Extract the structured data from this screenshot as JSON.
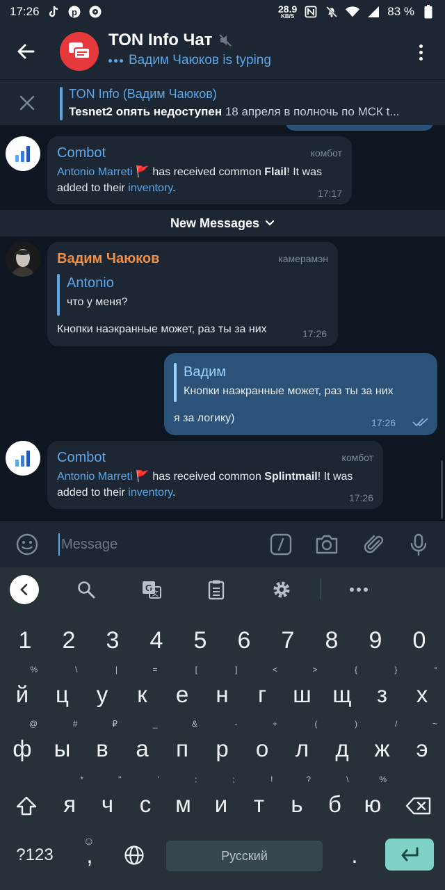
{
  "status_bar": {
    "time": "17:26",
    "net_speed_value": "28.9",
    "net_speed_unit": "KB/S",
    "battery": "83 %"
  },
  "header": {
    "title": "TON Info Чат",
    "typing_status": "Вадим Чаюков is typing",
    "avatar_color": "#e5393b"
  },
  "pinned": {
    "title": "TON Info (Вадим Чаюков)",
    "text_bold": "Tesnet2 опять недоступен",
    "text_rest": " 18 апреля в полночь по МСК t..."
  },
  "messages": [
    {
      "sender": "Combot",
      "role": "комбот",
      "link1": "Antonio Marreti",
      "flag": "🚩",
      "text1": " has received common ",
      "item": "Flail",
      "text2": "! It was",
      "line2_pre": "added to their ",
      "link2": "inventory",
      "line2_post": ".",
      "time": "17:17"
    },
    {
      "sender": "Вадим Чаюков",
      "role": "камерамэн",
      "reply_name": "Antonio",
      "reply_text": "что у меня?",
      "text": "Кнопки наэкранные может, раз ты за них",
      "time": "17:26"
    },
    {
      "reply_name": "Вадим",
      "reply_text": "Кнопки наэкранные может, раз ты за них",
      "text": "я за логику)",
      "time": "17:26"
    },
    {
      "sender": "Combot",
      "role": "комбот",
      "link1": "Antonio Marreti",
      "flag": "🚩",
      "text1": " has received common ",
      "item": "Splintmail",
      "text2": "! It was",
      "line2_pre": "added to their ",
      "link2": "inventory",
      "line2_post": ".",
      "time": "17:26"
    }
  ],
  "new_messages_label": "New Messages",
  "input": {
    "placeholder": "Message"
  },
  "keyboard": {
    "numbers": [
      "1",
      "2",
      "3",
      "4",
      "5",
      "6",
      "7",
      "8",
      "9",
      "0"
    ],
    "row1": [
      "й",
      "ц",
      "у",
      "к",
      "е",
      "н",
      "г",
      "ш",
      "щ",
      "з",
      "х"
    ],
    "row1_hints": [
      "%",
      "\\",
      "|",
      "=",
      "[",
      "]",
      "<",
      ">",
      "{",
      "}",
      "°"
    ],
    "row2": [
      "ф",
      "ы",
      "в",
      "а",
      "п",
      "р",
      "о",
      "л",
      "д",
      "ж",
      "э"
    ],
    "row2_hints": [
      "@",
      "#",
      "₽",
      "_",
      "&",
      "-",
      "+",
      "(",
      ")",
      "/",
      "~"
    ],
    "row3": [
      "я",
      "ч",
      "с",
      "м",
      "и",
      "т",
      "ь",
      "б",
      "ю"
    ],
    "row3_hints": [
      "*",
      "\"",
      "'",
      ":",
      ";",
      "!",
      "?",
      "\\",
      "%"
    ],
    "sym_key": "?123",
    "comma": ",",
    "space_label": "Русский",
    "period": "."
  },
  "colors": {
    "background": "#0e1621",
    "panel": "#1c2733",
    "accent": "#5fa6e8",
    "outgoing": "#2b5278",
    "keyboard": "#263238",
    "enter_key": "#7fd3c6"
  }
}
